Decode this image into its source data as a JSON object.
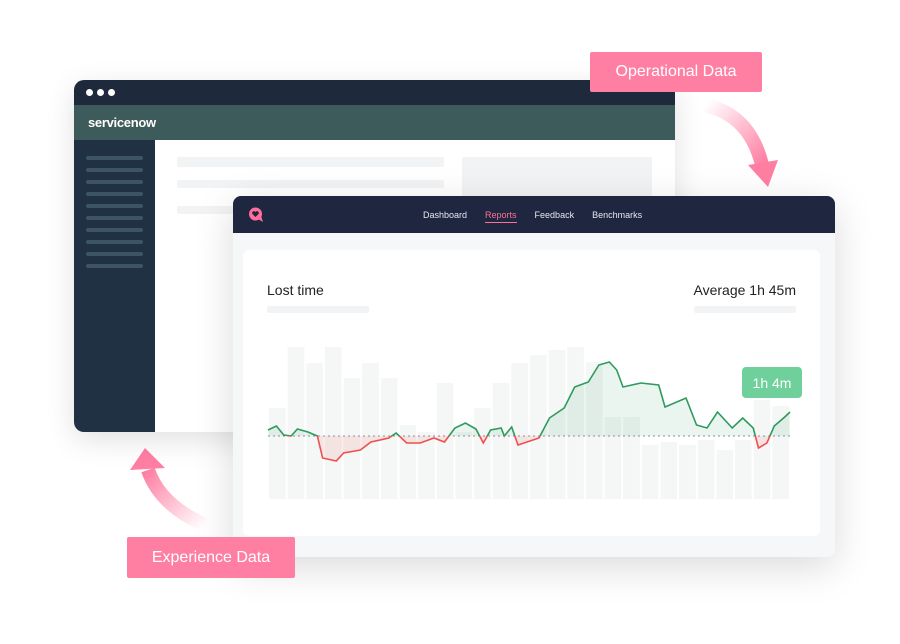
{
  "back_window": {
    "brand": "servicenow"
  },
  "front_window": {
    "nav": [
      {
        "label": "Dashboard"
      },
      {
        "label": "Reports",
        "active": true
      },
      {
        "label": "Feedback"
      },
      {
        "label": "Benchmarks"
      }
    ],
    "logo_icon": "heart-speech-bubble-icon",
    "card": {
      "title": "Lost time",
      "average": "Average 1h 45m",
      "badge": "1h 4m"
    }
  },
  "labels": {
    "operational": "Operational Data",
    "experience": "Experience Data"
  },
  "colors": {
    "accent": "#ff7fa3",
    "positive": "#2e9a5e",
    "negative": "#ef4f4f",
    "nav": "#1f2640",
    "servicenow_header": "#3e5b5b",
    "badge": "#6fd09b"
  },
  "chart_data": {
    "type": "line",
    "baseline": 0,
    "line": [
      [
        0,
        6
      ],
      [
        8,
        10
      ],
      [
        15,
        1
      ],
      [
        22,
        0
      ],
      [
        28,
        7
      ],
      [
        38,
        4
      ],
      [
        47,
        0
      ],
      [
        52,
        -22
      ],
      [
        65,
        -25
      ],
      [
        72,
        -17
      ],
      [
        88,
        -14
      ],
      [
        98,
        -6
      ],
      [
        115,
        -2
      ],
      [
        122,
        3
      ],
      [
        132,
        -7
      ],
      [
        145,
        -7
      ],
      [
        158,
        -2
      ],
      [
        168,
        -6
      ],
      [
        178,
        8
      ],
      [
        188,
        13
      ],
      [
        198,
        7
      ],
      [
        205,
        -7
      ],
      [
        212,
        6
      ],
      [
        222,
        8
      ],
      [
        225,
        0
      ],
      [
        232,
        9
      ],
      [
        238,
        -9
      ],
      [
        258,
        -2
      ],
      [
        268,
        18
      ],
      [
        282,
        28
      ],
      [
        292,
        49
      ],
      [
        305,
        54
      ],
      [
        315,
        71
      ],
      [
        325,
        74
      ],
      [
        332,
        66
      ],
      [
        338,
        49
      ],
      [
        355,
        53
      ],
      [
        372,
        51
      ],
      [
        378,
        29
      ],
      [
        398,
        38
      ],
      [
        408,
        11
      ],
      [
        418,
        8
      ],
      [
        428,
        24
      ],
      [
        442,
        8
      ],
      [
        452,
        18
      ],
      [
        462,
        8
      ],
      [
        467,
        -12
      ],
      [
        475,
        -7
      ],
      [
        482,
        10
      ],
      [
        492,
        19
      ],
      [
        497,
        24
      ]
    ],
    "bars": [
      28,
      89,
      73,
      89,
      58,
      73,
      58,
      11,
      4,
      53,
      4,
      28,
      53,
      73,
      81,
      86,
      89,
      74,
      19,
      19,
      -9,
      -6,
      -9,
      -4,
      -14,
      -4,
      36,
      30
    ],
    "bar_floor": -63
  }
}
